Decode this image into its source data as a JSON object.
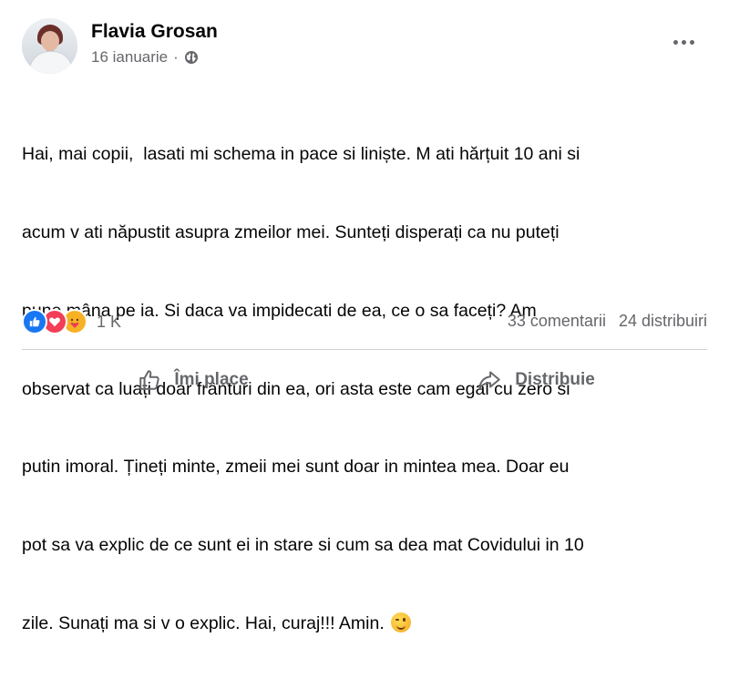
{
  "post": {
    "author": "Flavia Grosan",
    "date": "16 ianuarie",
    "separator": "·",
    "audience_icon": "globe-icon",
    "more_icon": "more-options-icon",
    "text_lines": [
      "Hai, mai copii,  lasati mi schema in pace si liniște. M ati hărțuit 10 ani si",
      "acum v ati năpustit asupra zmeilor mei. Sunteți disperați ca nu puteți",
      "pune mâna pe ia. Si daca va impidecati de ea, ce o sa faceți? Am",
      "observat ca luați doar frânturi din ea, ori asta este cam egal cu zero si",
      "putin imoral. Țineți minte, zmeii mei sunt doar in mintea mea. Doar eu",
      "pot sa va explic de ce sunt ei in stare si cum sa dea mat Covidului in 10",
      "zile. Sunați ma si v o explic. Hai, curaj!!! Amin."
    ],
    "emoji": "winking-face-emoji"
  },
  "stats": {
    "reactions": [
      "like",
      "love",
      "care"
    ],
    "reaction_count": "1 K",
    "comments": "33 comentarii",
    "shares": "24 distribuiri"
  },
  "actions": {
    "like_label": "Îmi place",
    "like_icon": "thumbs-up-icon",
    "share_label": "Distribuie",
    "share_icon": "share-arrow-icon"
  },
  "colors": {
    "text": "#050505",
    "secondary": "#65676b",
    "like_blue": "#1877f2",
    "love_red": "#f33e58",
    "care_yellow": "#f7b125",
    "divider": "#ced0d4"
  }
}
